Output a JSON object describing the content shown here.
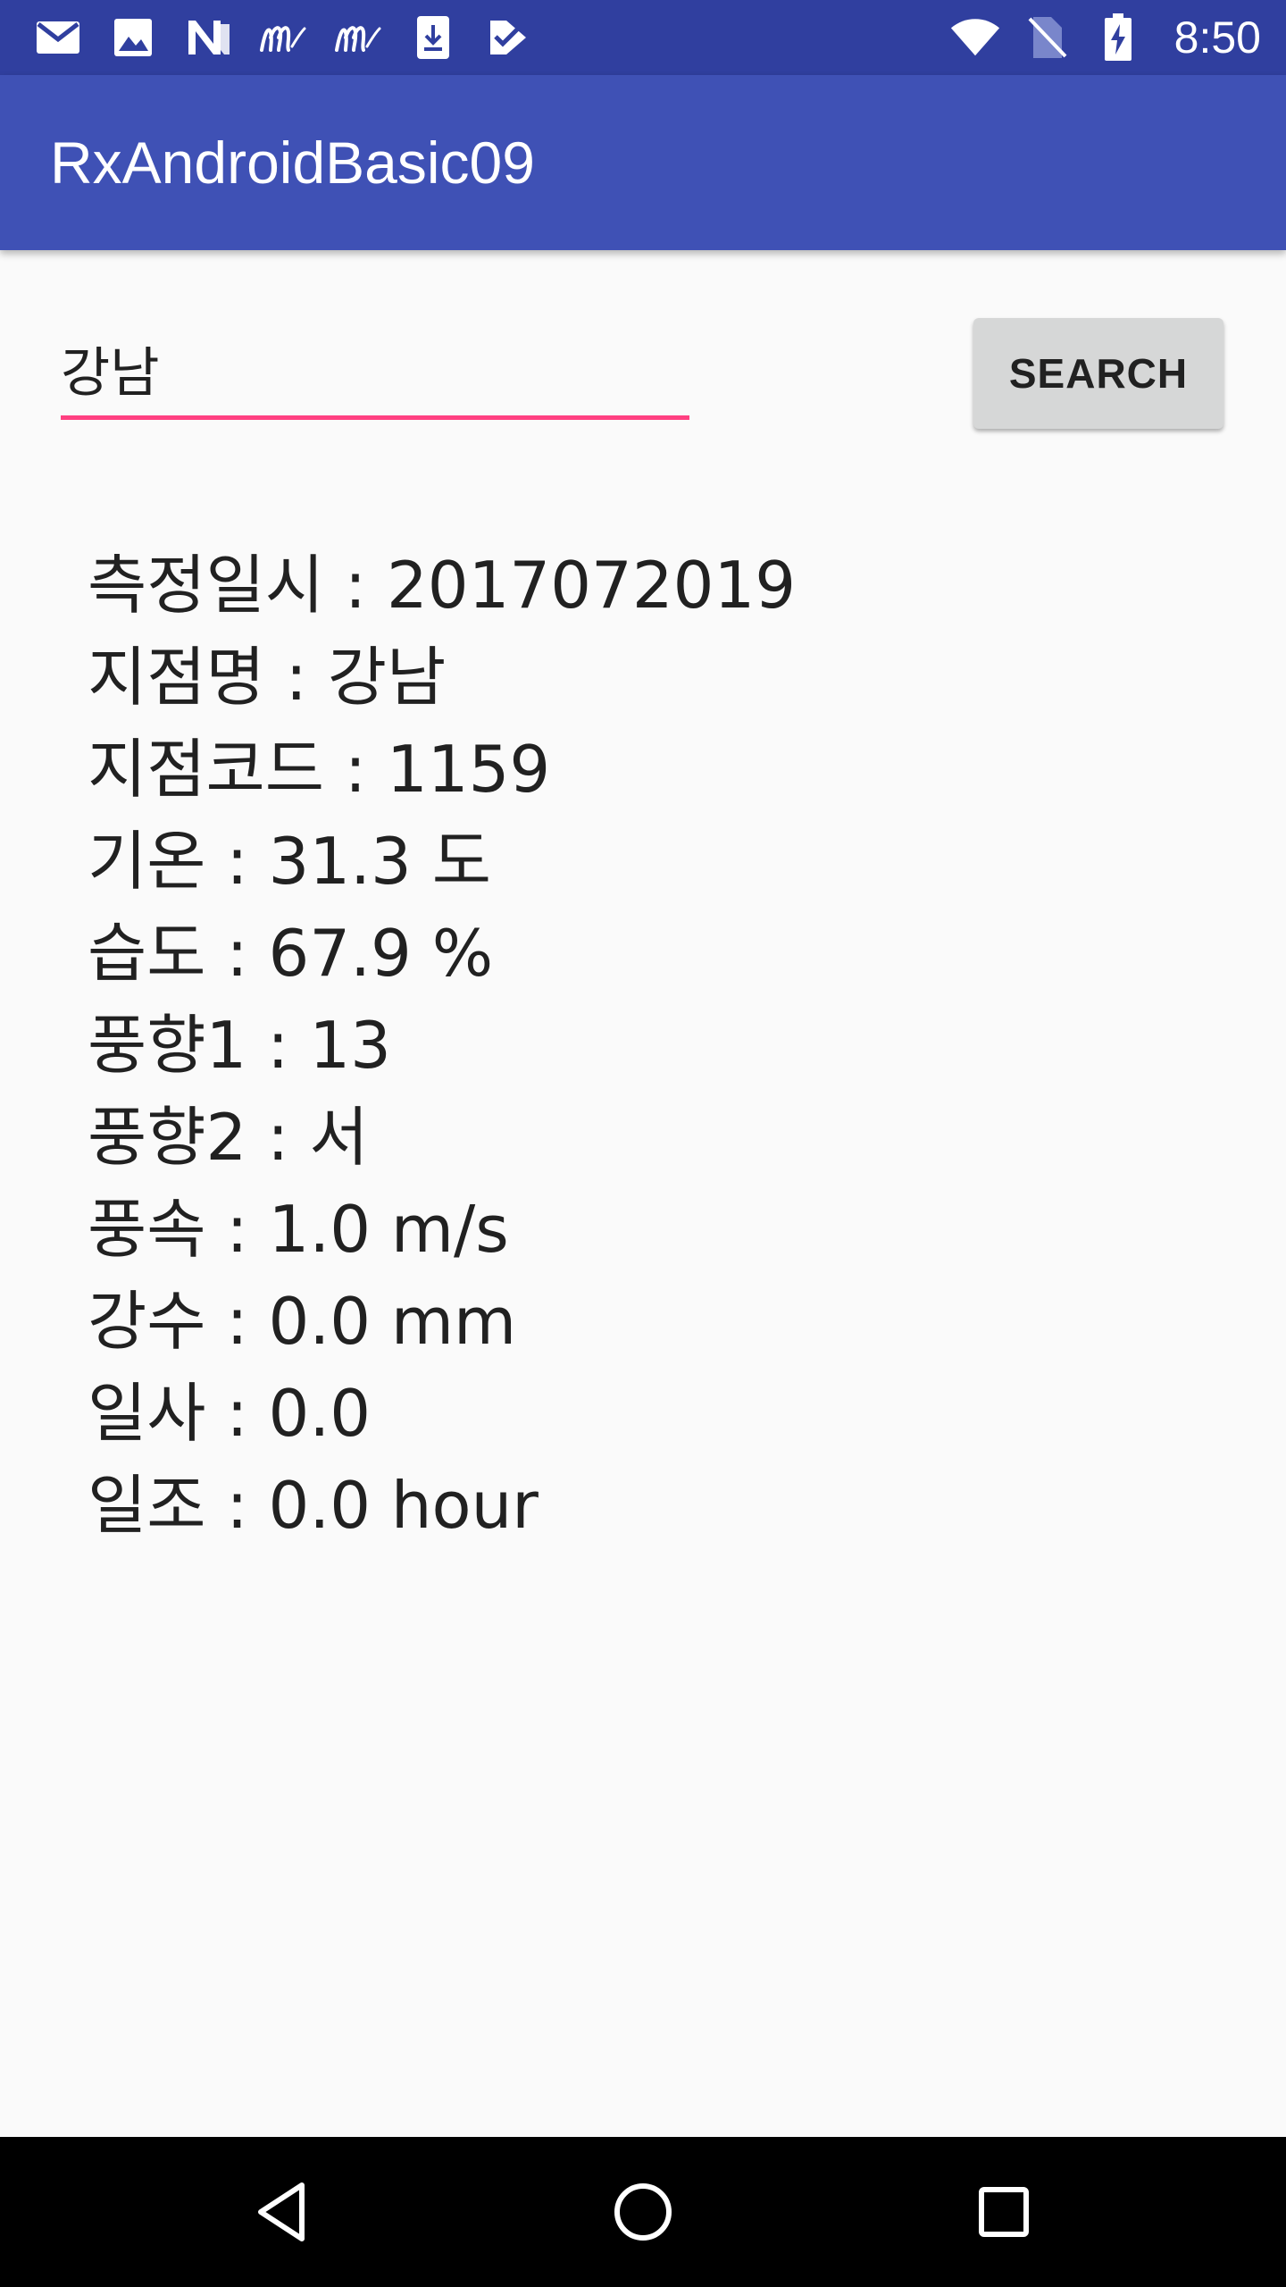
{
  "status_bar": {
    "time": "8:50",
    "notification_icons": [
      "gmail-icon",
      "image-icon",
      "n-app-icon",
      "m-app-icon",
      "m-app-icon",
      "download-icon",
      "check-tag-icon"
    ],
    "system_icons": [
      "wifi-icon",
      "no-sim-icon",
      "battery-charging-icon"
    ],
    "background": "#303f9f"
  },
  "app_bar": {
    "title": "RxAndroidBasic09",
    "background": "#3f51b5"
  },
  "search": {
    "input_value": "강남",
    "button_label": "SEARCH",
    "accent": "#ff4081"
  },
  "weather": {
    "lines": [
      "측정일시 : 2017072019",
      "지점명 : 강남",
      "지점코드 : 1159",
      "기온 : 31.3 도",
      "습도 : 67.9 %",
      "풍향1 : 13",
      "풍향2 : 서",
      "풍속 : 1.0 m/s",
      "강수 : 0.0 mm",
      "일사 : 0.0",
      "일조 : 0.0 hour"
    ]
  },
  "nav_bar": {
    "buttons": [
      "back-icon",
      "home-icon",
      "recents-icon"
    ]
  }
}
